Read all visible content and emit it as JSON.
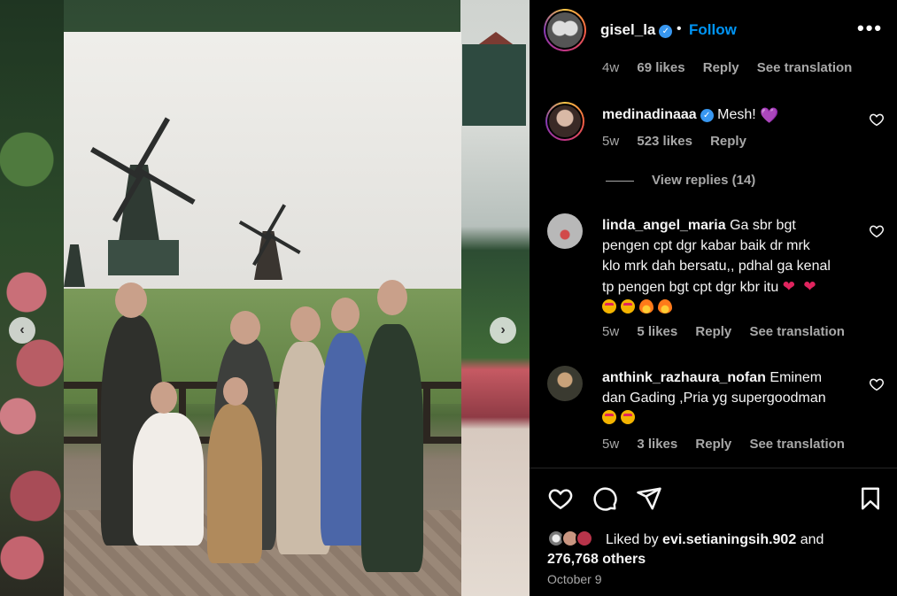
{
  "post": {
    "username": "gisel_la",
    "follow_label": "Follow",
    "more_label": "•••",
    "separator": "•"
  },
  "top_meta": {
    "time": "4w",
    "likes": "69 likes",
    "reply": "Reply",
    "translate": "See translation"
  },
  "comments": [
    {
      "username": "medinadinaaa",
      "verified": true,
      "text": "Mesh! ",
      "time": "5w",
      "likes": "523 likes",
      "reply": "Reply",
      "view_replies": "View replies (14)"
    },
    {
      "username": "linda_angel_maria",
      "lines": [
        "Ga sbr bgt",
        "pengen cpt dgr kabar baik dr mrk",
        "klo mrk dah bersatu,, pdhal ga kenal",
        "tp pengen bgt cpt dgr kbr itu "
      ],
      "time": "5w",
      "likes": "5 likes",
      "reply": "Reply",
      "translate": "See translation"
    },
    {
      "username": "anthink_razhaura_nofan",
      "lines": [
        "Eminem",
        "dan Gading ,Pria yg supergoodman"
      ],
      "time": "5w",
      "likes": "3 likes",
      "reply": "Reply",
      "translate": "See translation"
    }
  ],
  "liked": {
    "prefix": "Liked by",
    "user": "evi.setianingsih.902",
    "and": "and",
    "others": "276,768 others"
  },
  "date": "October 9",
  "colors": {
    "accent": "#0095f6",
    "verified": "#3897f0",
    "background": "#000000",
    "muted": "#a8a8a8"
  },
  "icons": [
    "heart-icon",
    "comment-icon",
    "share-icon",
    "bookmark-icon",
    "more-icon",
    "chevron-left-icon",
    "chevron-right-icon"
  ]
}
